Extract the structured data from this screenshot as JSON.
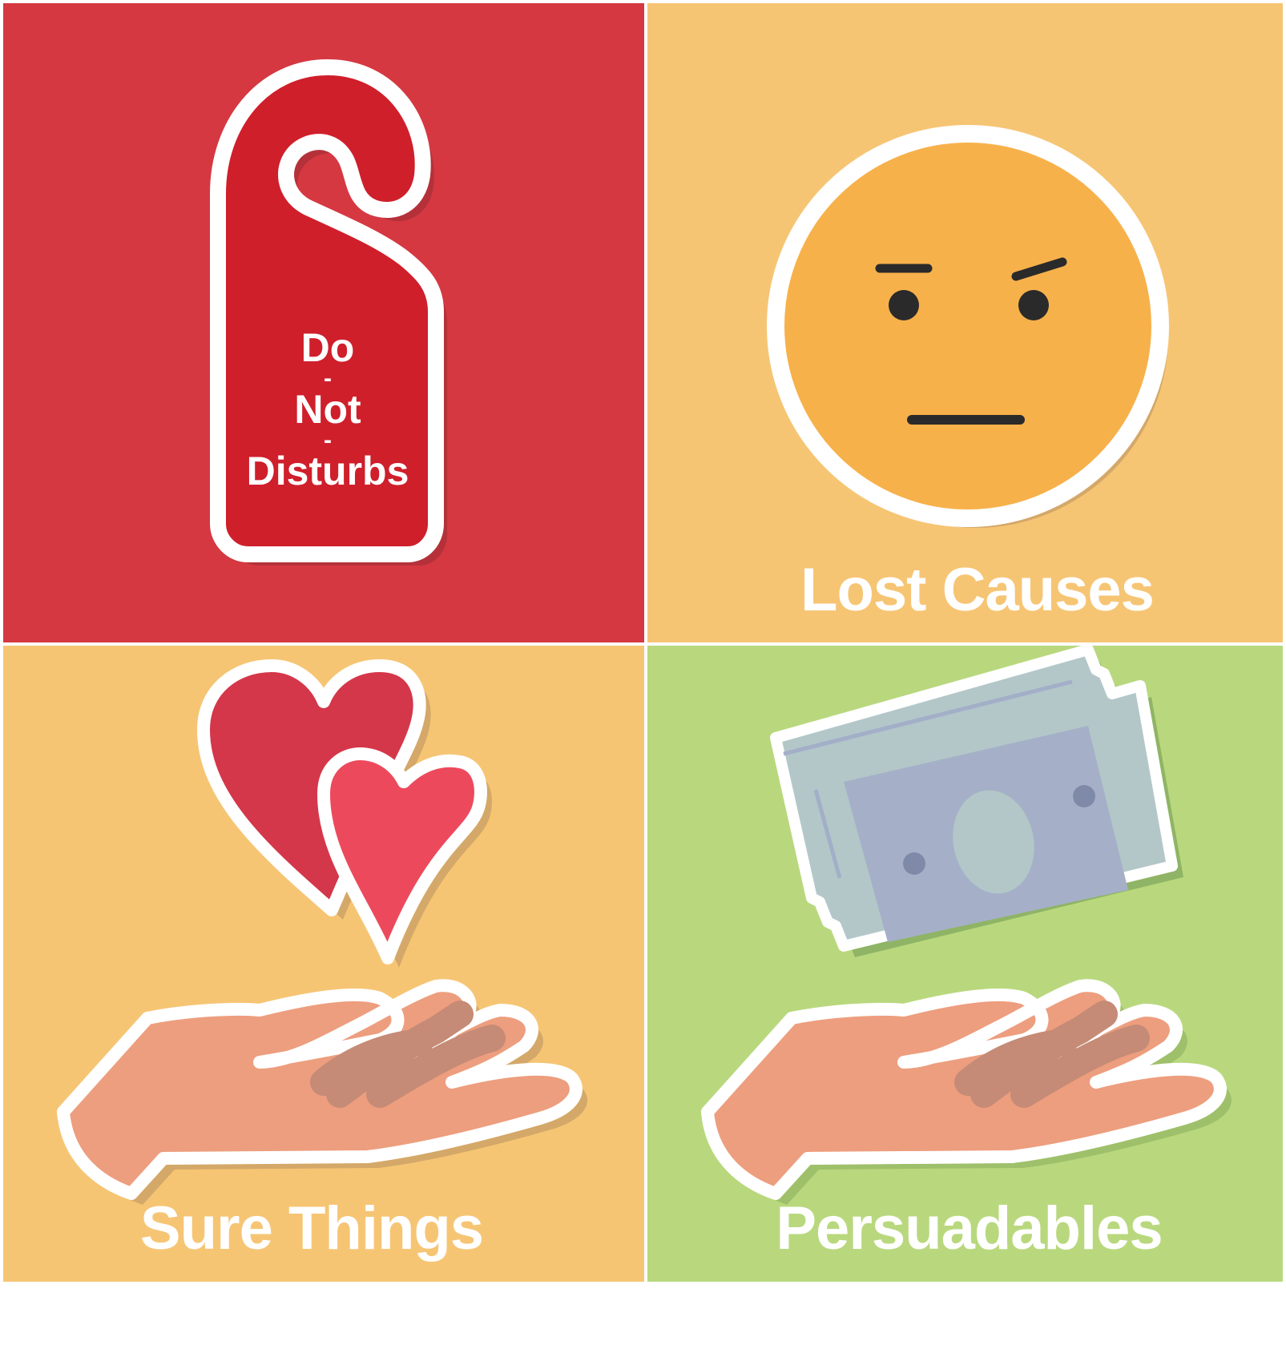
{
  "quadrants": {
    "top_left": {
      "color": "#d53841",
      "icon": "door-hanger-icon",
      "hanger_lines": [
        "Do",
        "-",
        "Not",
        "-",
        "Disturbs"
      ]
    },
    "top_right": {
      "color": "#f6c574",
      "icon": "neutral-face-icon",
      "label": "Lost Causes"
    },
    "bottom_left": {
      "color": "#f6c574",
      "icon": "hearts-in-hand-icon",
      "label": "Sure Things"
    },
    "bottom_right": {
      "color": "#b9d87e",
      "icon": "money-in-hand-icon",
      "label": "Persuadables"
    }
  }
}
